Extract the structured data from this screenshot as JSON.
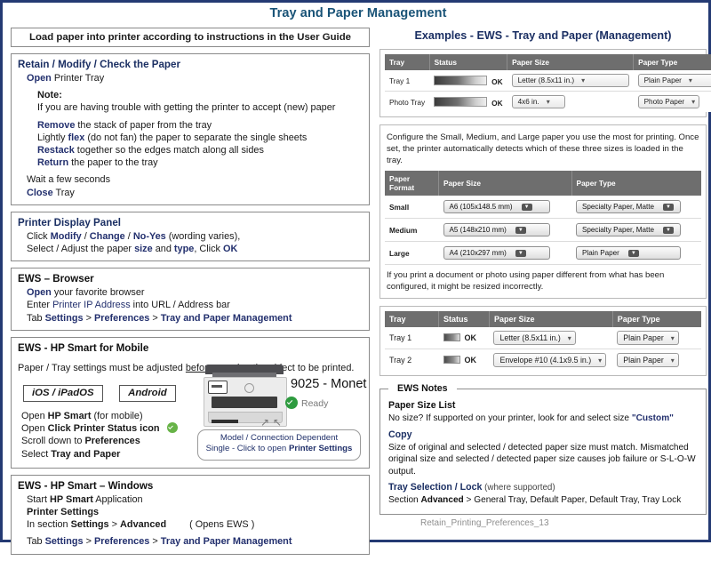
{
  "title": "Tray and Paper Management",
  "banner": "Load paper into printer according to instructions in the User Guide",
  "left": {
    "retain": {
      "header": "Retain / Modify / Check the Paper",
      "l1a": "Open",
      "l1b": " Printer Tray",
      "note_label": "Note:",
      "note_text": "If you are having trouble with getting the printer to accept (new) paper",
      "s1a": "Remove",
      "s1b": " the stack of paper from the tray",
      "s2a": "Lightly ",
      "s2b": "flex",
      "s2c": " (do not fan) the paper to separate the single sheets",
      "s3a": "Restack",
      "s3b": " together so the edges match along all sides",
      "s4a": "Return",
      "s4b": " the paper to the tray",
      "wait": "Wait a few seconds",
      "close_a": "Close",
      "close_b": " Tray"
    },
    "display_panel": {
      "header": "Printer Display Panel",
      "r1a": "Click ",
      "r1b": "Modify",
      "r1c": " / ",
      "r1d": "Change",
      "r1e": " / ",
      "r1f": "No-Yes",
      "r1g": " (wording varies),",
      "r2a": "Select / Adjust the paper ",
      "r2b": "size",
      "r2c": " and ",
      "r2d": "type",
      "r2e": ", Click ",
      "r2f": "OK"
    },
    "ews_browser": {
      "header": "EWS – Browser",
      "r1a": "Open",
      "r1b": " your favorite browser",
      "r2a": "Enter ",
      "r2b": "Printer IP Address",
      "r2c": " into URL / Address bar",
      "r3a": "Tab ",
      "r3b": "Settings",
      "r3c": " > ",
      "r3d": "Preferences",
      "r3e": " > ",
      "r3f": "Tray and Paper Management"
    },
    "ews_mobile": {
      "header": "EWS - HP Smart for Mobile",
      "intro_a": "Paper / Tray settings must be adjusted ",
      "intro_b": "before",
      "intro_c": " opening the object to be printed.",
      "chip_ios": "iOS / iPadOS",
      "chip_android": "Android",
      "s1a": "Open ",
      "s1b": "HP Smart",
      "s1c": " (for mobile)",
      "s2a": "Open ",
      "s2b": "Click Printer Status icon",
      "s3a": "Scroll down to ",
      "s3b": "Preferences",
      "s4a": "Select ",
      "s4b": "Tray and Paper",
      "printer_model": "9025 - Monet",
      "printer_status": "Ready",
      "callout_line1": "Model / Connection Dependent",
      "callout_line2a": "Single - Click to open ",
      "callout_line2b": "Printer Settings"
    },
    "ews_windows": {
      "header": "EWS - HP Smart – Windows",
      "r1a": "Start ",
      "r1b": "HP Smart",
      "r1c": " Application",
      "r2": "Printer Settings",
      "r3a": "In section ",
      "r3b": "Settings",
      "r3c": " > ",
      "r3d": "Advanced",
      "r3note": "( Opens EWS )",
      "r4a": "Tab ",
      "r4b": "Settings",
      "r4c": " > ",
      "r4d": "Preferences",
      "r4e": " > ",
      "r4f": "Tray and Paper Management"
    }
  },
  "right": {
    "heading": "Examples - EWS - Tray and Paper (Management)",
    "table1": {
      "columns": [
        "Tray",
        "Status",
        "Paper Size",
        "Paper Type"
      ],
      "rows": [
        {
          "tray": "Tray 1",
          "status": "OK",
          "paper_size": "Letter (8.5x11 in.)",
          "paper_type": "Plain Paper"
        },
        {
          "tray": "Photo Tray",
          "status": "OK",
          "paper_size": "4x6 in.",
          "paper_type": "Photo Paper"
        }
      ]
    },
    "config_note": "Configure the Small, Medium, and Large paper you use the most for printing.  Once set, the printer automatically detects which of these three sizes is loaded in the tray.",
    "table2": {
      "columns": [
        "Paper Format",
        "Paper Size",
        "Paper Type"
      ],
      "rows": [
        {
          "format": "Small",
          "paper_size": "A6 (105x148.5 mm)",
          "paper_type": "Specialty Paper, Matte"
        },
        {
          "format": "Medium",
          "paper_size": "A5 (148x210 mm)",
          "paper_type": "Specialty Paper, Matte"
        },
        {
          "format": "Large",
          "paper_size": "A4 (210x297 mm)",
          "paper_type": "Plain Paper"
        }
      ]
    },
    "config_warn": "If you print a document or photo using paper different from what has been configured, it might be resized incorrectly.",
    "table3": {
      "columns": [
        "Tray",
        "Status",
        "Paper Size",
        "Paper Type"
      ],
      "rows": [
        {
          "tray": "Tray 1",
          "status": "OK",
          "paper_size": "Letter (8.5x11 in.)",
          "paper_type": "Plain Paper"
        },
        {
          "tray": "Tray 2",
          "status": "OK",
          "paper_size": "Envelope #10 (4.1x9.5 in.)",
          "paper_type": "Plain Paper"
        }
      ]
    },
    "notes": {
      "legend": "EWS Notes",
      "n1_hdr": "Paper Size List",
      "n1a": "No size?  If supported on your printer, look for and select size ",
      "n1b": "\"Custom\"",
      "n2_hdr": "Copy",
      "n2": "Size of original and selected / detected paper size must match.  Mismatched original size and selected / detected paper size causes job failure or S-L-O-W output.",
      "n3_hdr_a": "Tray Selection / Lock",
      "n3_hdr_b": " (where supported)",
      "n3a": "Section ",
      "n3b": "Advanced",
      "n3c": " > General Tray, Default Paper, Default Tray, Tray Lock"
    }
  },
  "footer": "Retain_Printing_Preferences_13"
}
